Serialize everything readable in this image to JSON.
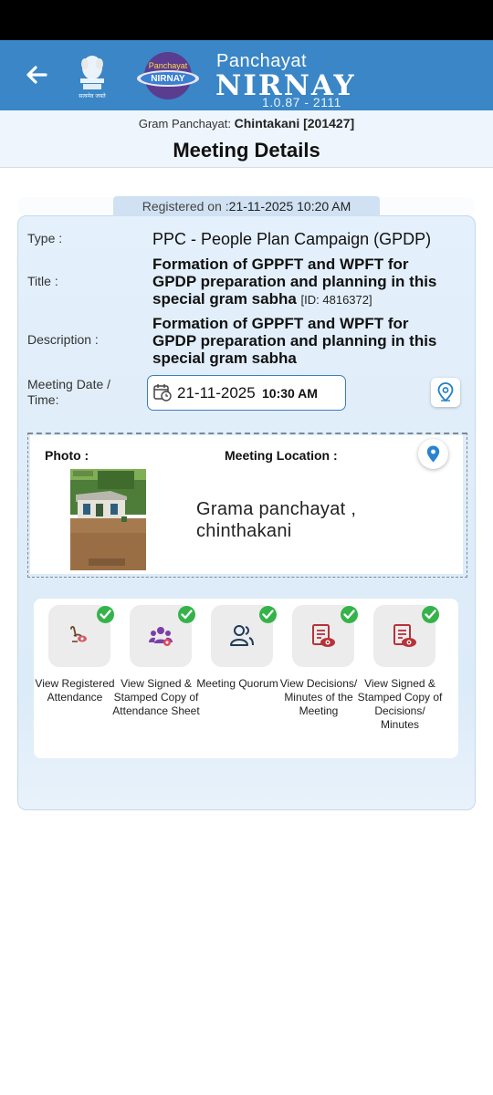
{
  "header": {
    "app_name_top": "Panchayat",
    "app_name_main": "NIRNAY",
    "version": "1.0.87 - 2111",
    "logo_text_top": "Panchayat",
    "logo_text_main": "NIRNAY",
    "emblem_caption": "सत्यमेव जयते"
  },
  "gram_panchayat": {
    "label": "Gram Panchayat:",
    "value": "Chintakani [201427]"
  },
  "page_title": "Meeting Details",
  "registered": {
    "label": "Registered on :",
    "value": "21-11-2025 10:20 AM"
  },
  "meeting": {
    "type_label": "Type :",
    "type_value": "PPC - People Plan Campaign (GPDP)",
    "title_label": "Title :",
    "title_value": "Formation of GPPFT and WPFT for GPDP preparation and planning in this special gram sabha",
    "title_id": "[ID: 4816372]",
    "description_label": "Description :",
    "description_value": "Formation of GPPFT and WPFT for GPDP preparation and planning in this special gram sabha",
    "datetime_label": "Meeting Date / Time:",
    "date_value": "21-11-2025",
    "time_value": "10:30 AM"
  },
  "location": {
    "photo_label": "Photo :",
    "location_label": "Meeting Location :",
    "location_text": "Grama panchayat , chinthakani"
  },
  "actions": [
    {
      "label": "View Registered Attendance",
      "icon": "attendance-icon",
      "done": true
    },
    {
      "label": "View Signed & Stamped Copy of Attendance Sheet",
      "icon": "group-icon",
      "done": true
    },
    {
      "label": "Meeting Quorum",
      "icon": "quorum-icon",
      "done": true
    },
    {
      "label": "View Decisions/ Minutes of the Meeting",
      "icon": "document-view-icon",
      "done": true
    },
    {
      "label": "View Signed & Stamped Copy of Decisions/ Minutes",
      "icon": "document-view-icon",
      "done": true
    }
  ],
  "colors": {
    "appbar": "#3a86c6",
    "accent_green": "#35b34a",
    "doc_red": "#c0392b",
    "group_purple": "#7b3fa8"
  }
}
